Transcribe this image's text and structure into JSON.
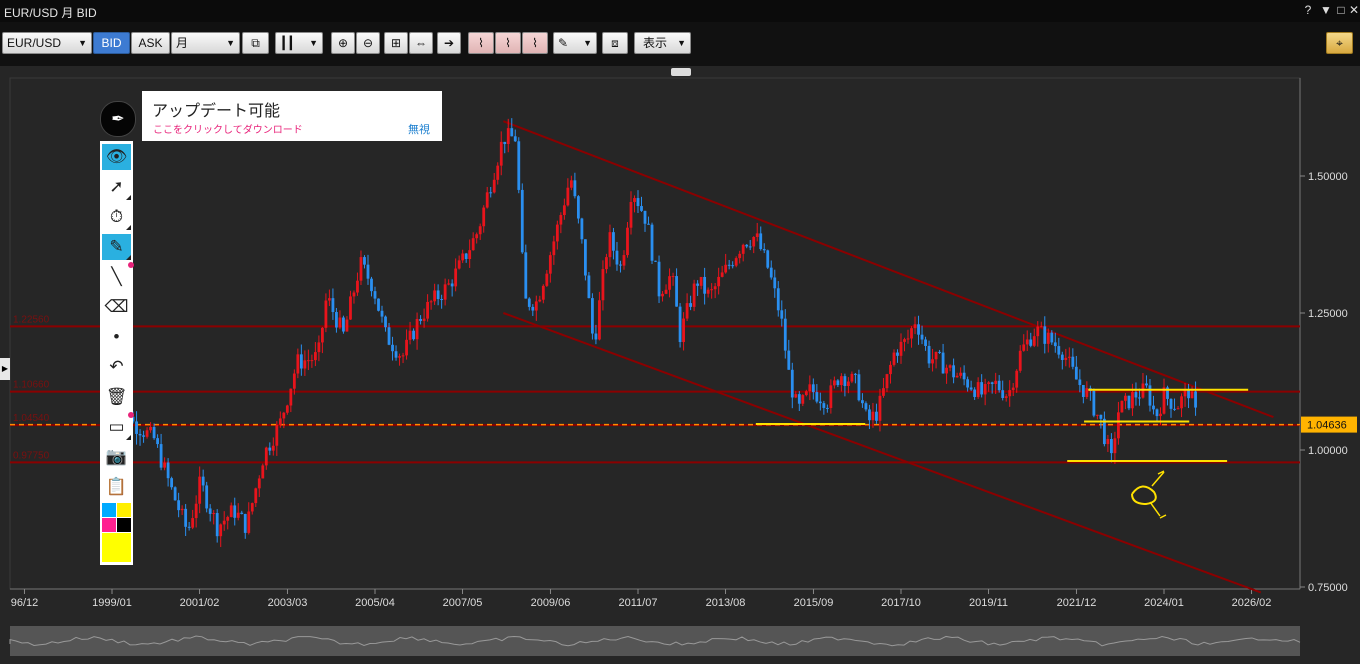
{
  "window": {
    "title": "EUR/USD 月 BID",
    "buttons": [
      "?",
      "▼",
      "□",
      "✕"
    ]
  },
  "toolbar": {
    "symbol": "EUR/USD",
    "bid": "BID",
    "ask": "ASK",
    "period": "月",
    "display_menu": "表示",
    "crosshair_icon": "crosshair-icon"
  },
  "popup": {
    "title": "アップデート可能",
    "download_link": "ここをクリックしてダウンロード",
    "ignore": "無視"
  },
  "palette_colors": [
    "#00aaff",
    "#ffef00",
    "#ff2090",
    "#000000",
    "#ffff00"
  ],
  "chart_data": {
    "type": "candlestick",
    "symbol": "EUR/USD",
    "timeframe": "月",
    "price_side": "BID",
    "ylim": [
      0.73,
      1.66
    ],
    "y_ticks": [
      0.75,
      1.0,
      1.25,
      1.5
    ],
    "y_tick_labels": [
      "0.75000",
      "1.00000",
      "1.25000",
      "1.50000"
    ],
    "x_ticks": [
      "96/12",
      "1999/01",
      "2001/02",
      "2003/03",
      "2005/04",
      "2007/05",
      "2009/06",
      "2011/07",
      "2013/08",
      "2015/09",
      "2017/10",
      "2019/11",
      "2021/12",
      "2024/01",
      "2026/02"
    ],
    "x_tick_dates": [
      1996.92,
      1999.0,
      2001.08,
      2003.17,
      2005.25,
      2007.33,
      2009.42,
      2011.5,
      2013.58,
      2015.67,
      2017.75,
      2019.83,
      2021.92,
      2024.0,
      2026.08
    ],
    "current_price": 1.04636,
    "current_price_label": "1.04636",
    "horizontal_levels": [
      {
        "value": 1.2256,
        "label": "1.22560"
      },
      {
        "value": 1.1066,
        "label": "1.10660"
      },
      {
        "value": 1.0454,
        "label": "1.04540"
      },
      {
        "value": 0.9775,
        "label": "0.97750"
      }
    ],
    "price_path": [
      [
        1999.0,
        1.17
      ],
      [
        1999.5,
        1.05
      ],
      [
        2000.0,
        1.02
      ],
      [
        2000.4,
        0.93
      ],
      [
        2000.8,
        0.85
      ],
      [
        2001.1,
        0.94
      ],
      [
        2001.5,
        0.86
      ],
      [
        2001.9,
        0.89
      ],
      [
        2002.2,
        0.86
      ],
      [
        2002.6,
        0.99
      ],
      [
        2003.0,
        1.05
      ],
      [
        2003.4,
        1.16
      ],
      [
        2003.9,
        1.17
      ],
      [
        2004.1,
        1.28
      ],
      [
        2004.5,
        1.21
      ],
      [
        2004.9,
        1.34
      ],
      [
        2005.2,
        1.3
      ],
      [
        2005.5,
        1.21
      ],
      [
        2005.9,
        1.17
      ],
      [
        2006.3,
        1.24
      ],
      [
        2006.6,
        1.27
      ],
      [
        2007.0,
        1.3
      ],
      [
        2007.3,
        1.34
      ],
      [
        2007.7,
        1.4
      ],
      [
        2007.9,
        1.46
      ],
      [
        2008.3,
        1.57
      ],
      [
        2008.6,
        1.57
      ],
      [
        2008.8,
        1.27
      ],
      [
        2009.1,
        1.27
      ],
      [
        2009.6,
        1.41
      ],
      [
        2009.9,
        1.5
      ],
      [
        2010.2,
        1.36
      ],
      [
        2010.45,
        1.19
      ],
      [
        2010.8,
        1.39
      ],
      [
        2011.1,
        1.33
      ],
      [
        2011.35,
        1.48
      ],
      [
        2011.7,
        1.42
      ],
      [
        2012.0,
        1.29
      ],
      [
        2012.3,
        1.32
      ],
      [
        2012.5,
        1.21
      ],
      [
        2012.9,
        1.31
      ],
      [
        2013.2,
        1.28
      ],
      [
        2013.6,
        1.33
      ],
      [
        2014.0,
        1.38
      ],
      [
        2014.3,
        1.39
      ],
      [
        2014.6,
        1.33
      ],
      [
        2014.9,
        1.24
      ],
      [
        2015.1,
        1.13
      ],
      [
        2015.3,
        1.07
      ],
      [
        2015.6,
        1.11
      ],
      [
        2016.0,
        1.09
      ],
      [
        2016.3,
        1.14
      ],
      [
        2016.7,
        1.12
      ],
      [
        2016.95,
        1.05
      ],
      [
        2017.2,
        1.07
      ],
      [
        2017.6,
        1.18
      ],
      [
        2017.9,
        1.2
      ],
      [
        2018.1,
        1.24
      ],
      [
        2018.4,
        1.17
      ],
      [
        2018.7,
        1.16
      ],
      [
        2019.0,
        1.14
      ],
      [
        2019.4,
        1.12
      ],
      [
        2019.7,
        1.1
      ],
      [
        2020.0,
        1.12
      ],
      [
        2020.3,
        1.1
      ],
      [
        2020.6,
        1.18
      ],
      [
        2020.95,
        1.22
      ],
      [
        2021.3,
        1.2
      ],
      [
        2021.6,
        1.18
      ],
      [
        2021.9,
        1.13
      ],
      [
        2022.2,
        1.1
      ],
      [
        2022.5,
        1.05
      ],
      [
        2022.75,
        0.98
      ],
      [
        2022.9,
        1.07
      ],
      [
        2023.3,
        1.1
      ],
      [
        2023.6,
        1.11
      ],
      [
        2023.8,
        1.06
      ],
      [
        2024.0,
        1.1
      ],
      [
        2024.3,
        1.08
      ],
      [
        2024.6,
        1.11
      ],
      [
        2024.8,
        1.05
      ]
    ],
    "channel_lines": [
      {
        "x1": 2008.3,
        "y1": 1.6,
        "x2": 2026.6,
        "y2": 1.06
      },
      {
        "x1": 2008.3,
        "y1": 1.25,
        "x2": 2026.3,
        "y2": 0.74
      }
    ],
    "annotations": [
      {
        "kind": "support",
        "x1": 2014.3,
        "x2": 2016.9,
        "y": 1.0475
      },
      {
        "kind": "support",
        "x1": 2022.2,
        "x2": 2026.0,
        "y": 1.11
      },
      {
        "kind": "support",
        "x1": 2022.1,
        "x2": 2024.6,
        "y": 1.052
      },
      {
        "kind": "support",
        "x1": 2021.7,
        "x2": 2025.5,
        "y": 0.98
      }
    ]
  }
}
